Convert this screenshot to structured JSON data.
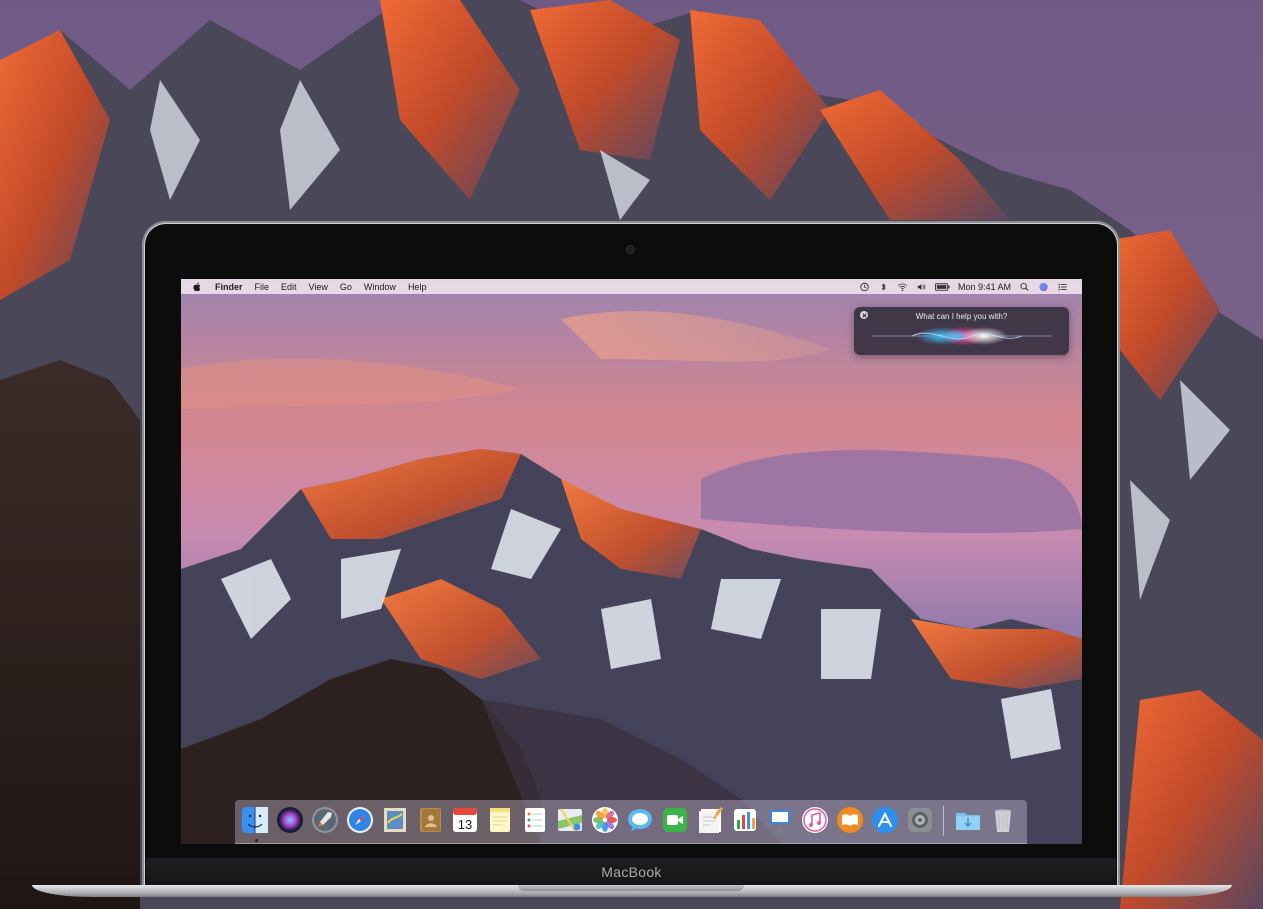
{
  "device": {
    "brand_label": "MacBook"
  },
  "menubar": {
    "app_name": "Finder",
    "items": [
      "File",
      "Edit",
      "View",
      "Go",
      "Window",
      "Help"
    ],
    "clock": "Mon 9:41 AM",
    "status_icons": [
      "time-machine-icon",
      "bluetooth-icon",
      "wifi-icon",
      "volume-icon",
      "battery-icon"
    ],
    "right_icons": [
      "spotlight-search-icon",
      "siri-menu-icon",
      "notification-center-icon"
    ]
  },
  "siri": {
    "prompt": "What can I help you with?"
  },
  "dock": {
    "apps": [
      {
        "name": "finder-icon",
        "color": "#3a8ff0"
      },
      {
        "name": "siri-icon",
        "color": "#1a1a3a"
      },
      {
        "name": "launchpad-icon",
        "color": "#8f97a3"
      },
      {
        "name": "safari-icon",
        "color": "#2f86e8"
      },
      {
        "name": "mail-icon",
        "color": "#5c8ec6"
      },
      {
        "name": "contacts-icon",
        "color": "#b58a4b"
      },
      {
        "name": "calendar-icon",
        "color": "#ffffff",
        "text": "13"
      },
      {
        "name": "notes-icon",
        "color": "#f7e07a"
      },
      {
        "name": "reminders-icon",
        "color": "#ffffff"
      },
      {
        "name": "maps-icon",
        "color": "#8cc46d"
      },
      {
        "name": "photos-icon",
        "color": "#ffffff"
      },
      {
        "name": "messages-icon",
        "color": "#58b7f5"
      },
      {
        "name": "facetime-icon",
        "color": "#3bb54a"
      },
      {
        "name": "pages-icon",
        "color": "#f4a640"
      },
      {
        "name": "numbers-icon",
        "color": "#2aa84a"
      },
      {
        "name": "keynote-icon",
        "color": "#3f86e0"
      },
      {
        "name": "itunes-icon",
        "color": "#e85a9f"
      },
      {
        "name": "ibooks-icon",
        "color": "#f08b22"
      },
      {
        "name": "app-store-icon",
        "color": "#2d8ff0"
      },
      {
        "name": "system-preferences-icon",
        "color": "#8a8d92"
      }
    ],
    "extras": [
      {
        "name": "downloads-folder-icon",
        "color": "#78c3ee"
      },
      {
        "name": "trash-icon",
        "color": "#d8dadd"
      }
    ]
  }
}
